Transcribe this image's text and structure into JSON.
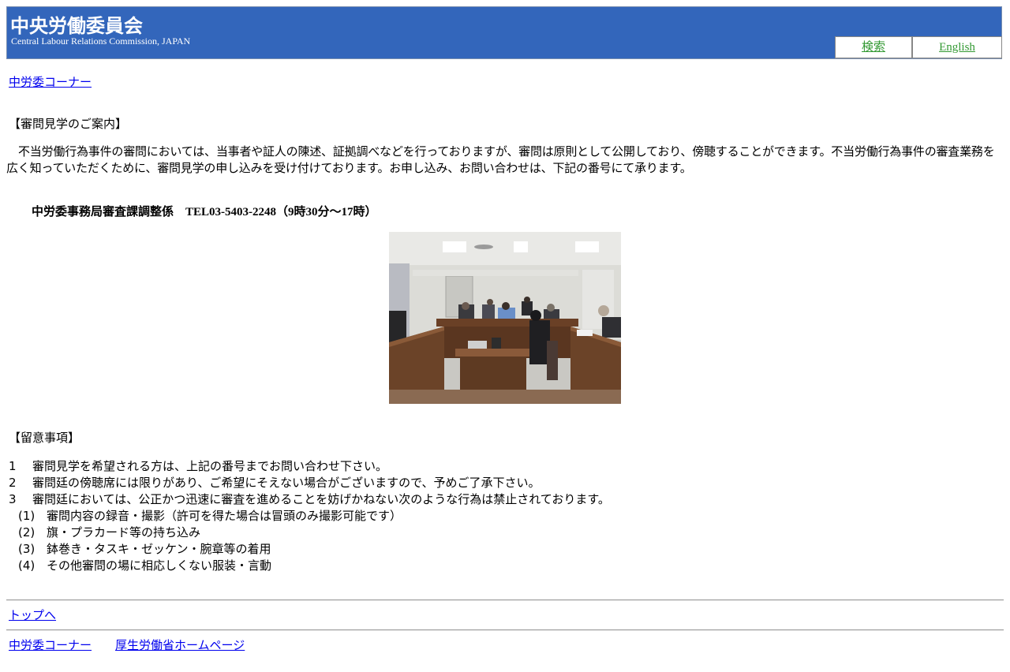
{
  "header": {
    "title": "中央労働委員会",
    "subtitle": "Central Labour Relations Commission, JAPAN",
    "search_label": "検索",
    "english_label": "English"
  },
  "breadcrumb": {
    "link": "中労委コーナー"
  },
  "main": {
    "heading": "【審問見学のご案内】",
    "paragraph": "不当労働行為事件の審問においては、当事者や証人の陳述、証拠調べなどを行っておりますが、審問は原則として公開しており、傍聴することができます。不当労働行為事件の審査業務を広く知っていただくために、審問見学の申し込みを受け付けております。お申し込み、お問い合わせは、下記の番号にて承ります。",
    "contact": "中労委事務局審査課調整係　TEL03-5403-2248（9時30分～17時）",
    "notes_heading": "【留意事項】",
    "notes": [
      {
        "num": "1",
        "text": "審問見学を希望される方は、上記の番号までお問い合わせ下さい。"
      },
      {
        "num": "2",
        "text": "審問廷の傍聴席には限りがあり、ご希望にそえない場合がございますので、予めご了承下さい。"
      },
      {
        "num": "3",
        "text": "審問廷においては、公正かつ迅速に審査を進めることを妨げかねない次のような行為は禁止されております。"
      }
    ],
    "subnotes": [
      {
        "num": "(1)",
        "text": "審問内容の録音・撮影（許可を得た場合は冒頭のみ撮影可能です）"
      },
      {
        "num": "(2)",
        "text": "旗・プラカード等の持ち込み"
      },
      {
        "num": "(3)",
        "text": "鉢巻き・タスキ・ゼッケン・腕章等の着用"
      },
      {
        "num": "(4)",
        "text": "その他審問の場に相応しくない服装・言動"
      }
    ]
  },
  "footer": {
    "top_link": "トップへ",
    "corner_link": "中労委コーナー",
    "mhlw_link": "厚生労働省ホームページ"
  },
  "colors": {
    "header_bg": "#3366bb",
    "link": "#0000ee",
    "nav_link": "#339933"
  }
}
